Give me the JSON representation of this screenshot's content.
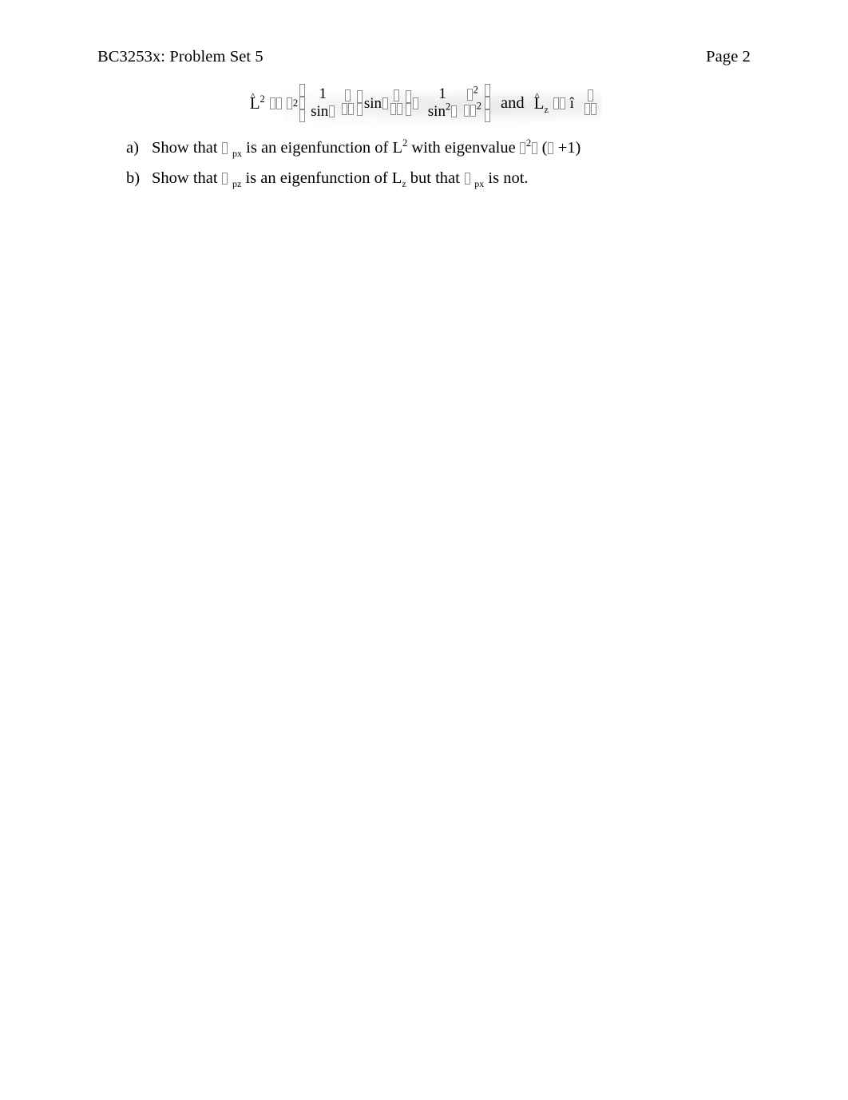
{
  "document": {
    "header": {
      "course_title": "BC3253x: Problem Set 5",
      "page_label": "Page 2"
    },
    "equation": {
      "description": "Angular momentum operators in spherical coordinates",
      "operator_L2_symbol": "L",
      "operator_L2_exponent": "2",
      "operator_L2_hat": "^",
      "equals_glyph": "☐",
      "minus_glyph": "☐",
      "hbar_glyph": "☐",
      "hbar_exponent": "2",
      "frac1_numerator": "1",
      "frac1_denominator_sin": "sin",
      "frac1_denominator_theta": "☐",
      "frac1_denominator_partial": "☐",
      "frac1_numerator_partial": "☐",
      "sin_term": "sin",
      "theta_glyph": "☐",
      "partial_glyph": "☐",
      "frac2_numerator": "1",
      "frac2_denominator_sin": "sin",
      "frac2_denominator_exponent": "2",
      "frac2_numerator_partial_exponent": "2",
      "frac2_denominator_phi_exponent": "2",
      "conjunction": "and",
      "operator_Lz_symbol": "L",
      "operator_Lz_subscript": "z",
      "i_glyph": "î",
      "phi_glyph": "☐"
    },
    "problems": [
      {
        "marker": "a)",
        "segments": {
          "lead": "Show that",
          "psi_glyph": "☐",
          "psi_subscript": "px",
          "middle": "is an eigenfunction of L",
          "L_exponent": "2",
          "tail": "with eigenvalue",
          "hbar_glyph": "☐",
          "hbar_exponent": "2",
          "l_glyph": "☐",
          "eigenvalue_paren_open": "(",
          "l_glyph_2": "☐",
          "eigenvalue_plus_one": "+1",
          "eigenvalue_paren_close": ")"
        }
      },
      {
        "marker": "b)",
        "segments": {
          "lead": "Show that",
          "psi_glyph": "☐",
          "psi_subscript": "pz",
          "middle": "is an eigenfunction of L",
          "L_subscript": "z",
          "tail": "but that",
          "psi_glyph_2": "☐",
          "psi_subscript_2": "px",
          "end": "is not."
        }
      }
    ]
  },
  "colors": {
    "page_background": "#ffffff",
    "text": "#000000",
    "missing_glyph_border": "#8d8d8d"
  }
}
